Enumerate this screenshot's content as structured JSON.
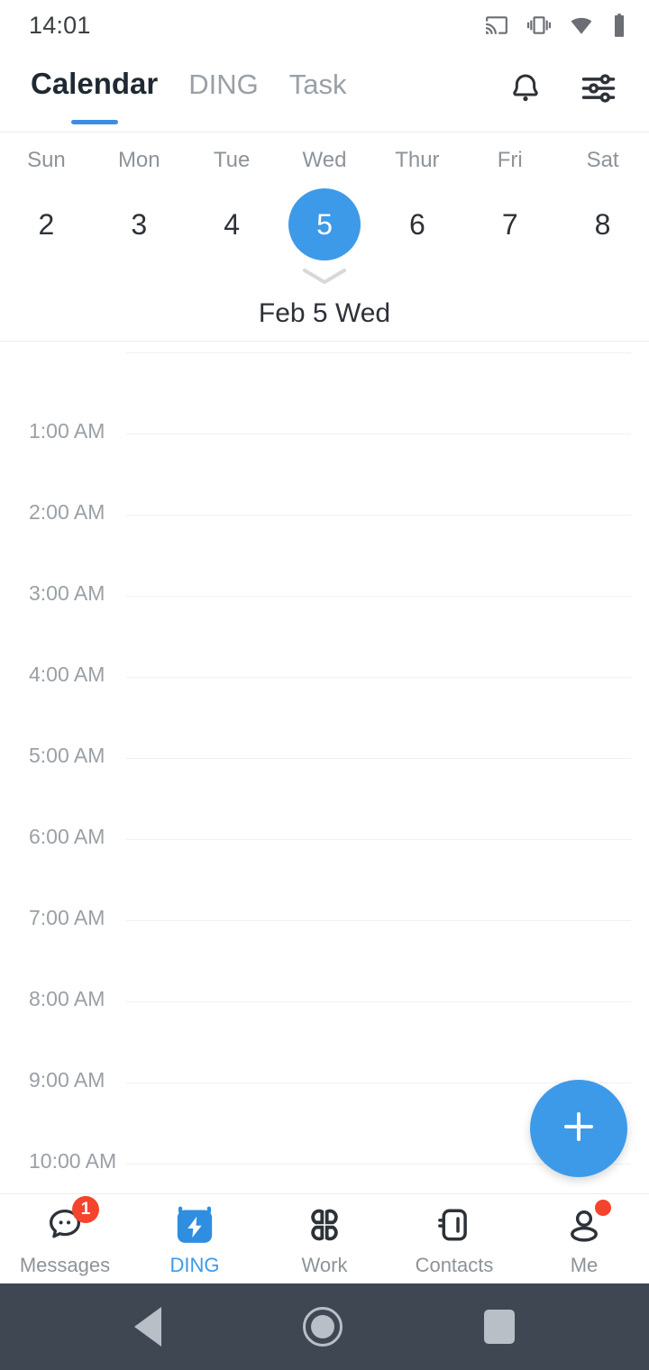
{
  "status_bar": {
    "time": "14:01",
    "icons": [
      "cast-icon",
      "vibrate-icon",
      "wifi-icon",
      "battery-icon"
    ]
  },
  "header": {
    "tabs": [
      {
        "label": "Calendar",
        "active": true
      },
      {
        "label": "DING",
        "active": false
      },
      {
        "label": "Task",
        "active": false
      }
    ],
    "actions": [
      {
        "name": "notification-bell-icon",
        "label": "Notifications"
      },
      {
        "name": "filter-sliders-icon",
        "label": "Settings"
      }
    ],
    "active_indicator_color": "#3d8ee0"
  },
  "week_strip": {
    "days": [
      {
        "dow": "Sun",
        "date": "2",
        "selected": false
      },
      {
        "dow": "Mon",
        "date": "3",
        "selected": false
      },
      {
        "dow": "Tue",
        "date": "4",
        "selected": false
      },
      {
        "dow": "Wed",
        "date": "5",
        "selected": true
      },
      {
        "dow": "Thur",
        "date": "6",
        "selected": false
      },
      {
        "dow": "Fri",
        "date": "7",
        "selected": false
      },
      {
        "dow": "Sat",
        "date": "8",
        "selected": false
      }
    ],
    "selected_day_label": "Feb 5 Wed",
    "selected_color": "#3d9ae8",
    "expand_icon": "chevron-down-icon"
  },
  "schedule": {
    "hours": [
      "1:00 AM",
      "2:00 AM",
      "3:00 AM",
      "4:00 AM",
      "5:00 AM",
      "6:00 AM",
      "7:00 AM",
      "8:00 AM",
      "9:00 AM",
      "10:00 AM"
    ],
    "events": [],
    "fab": {
      "icon": "plus-icon",
      "label": "Create event",
      "color": "#3d9ae8"
    }
  },
  "bottom_nav": [
    {
      "label": "Messages",
      "icon": "chat-bubble-icon",
      "active": false,
      "badge_count": "1"
    },
    {
      "label": "DING",
      "icon": "ding-lightning-icon",
      "active": true,
      "badge_count": ""
    },
    {
      "label": "Work",
      "icon": "grid-apps-icon",
      "active": false,
      "badge_count": ""
    },
    {
      "label": "Contacts",
      "icon": "address-book-icon",
      "active": false,
      "badge_count": ""
    },
    {
      "label": "Me",
      "icon": "person-icon",
      "active": false,
      "badge_dot": true
    }
  ],
  "system_nav": {
    "buttons": [
      "back-button",
      "home-button",
      "recents-button"
    ],
    "background": "#3e4752"
  }
}
